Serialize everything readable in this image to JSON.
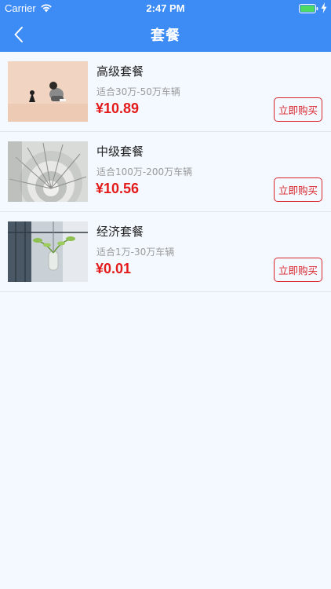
{
  "status_bar": {
    "carrier": "Carrier",
    "time": "2:47 PM",
    "icons": [
      "wifi-icon",
      "battery-icon",
      "charging-bolt-icon"
    ]
  },
  "nav": {
    "title": "套餐",
    "back_icon": "chevron-left-icon"
  },
  "colors": {
    "header": "#3d8bf5",
    "background": "#f3f9ff",
    "price": "#e31b1b",
    "button_border": "#d9262c",
    "battery": "#4cd964"
  },
  "packages": [
    {
      "name": "高级套餐",
      "range": "适合30万-50万车辆",
      "price": "¥10.89",
      "button": "立即购买"
    },
    {
      "name": "中级套餐",
      "range": "适合100万-200万车辆",
      "price": "¥10.56",
      "button": "立即购买"
    },
    {
      "name": "经济套餐",
      "range": "适合1万-30万车辆",
      "price": "¥0.01",
      "button": "立即购买"
    }
  ]
}
